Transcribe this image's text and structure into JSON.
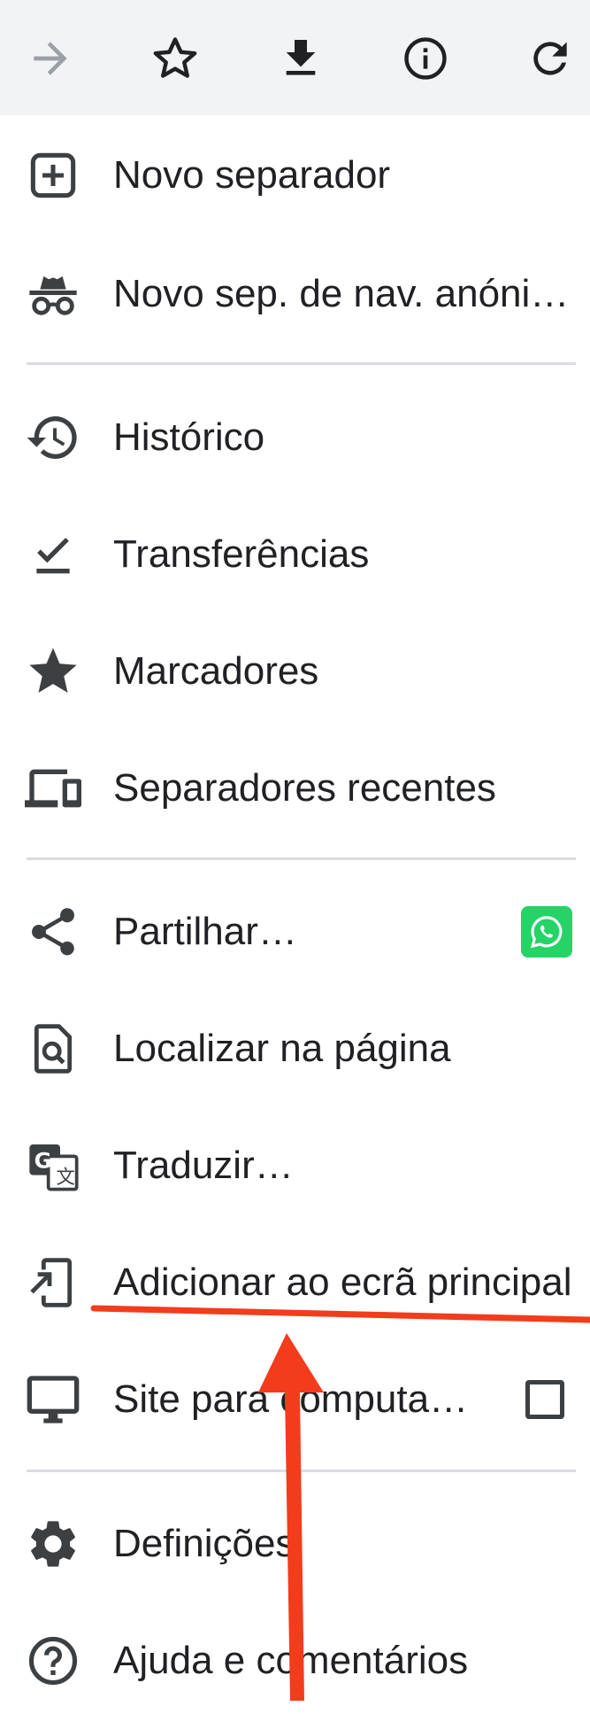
{
  "toolbar": {
    "buttons": [
      {
        "name": "forward-button",
        "icon": "arrow-forward-icon",
        "enabled": false
      },
      {
        "name": "bookmark-star-button",
        "icon": "star-outline-icon"
      },
      {
        "name": "download-button",
        "icon": "download-icon"
      },
      {
        "name": "page-info-button",
        "icon": "info-icon"
      },
      {
        "name": "reload-button",
        "icon": "reload-icon"
      }
    ]
  },
  "menu": {
    "items": [
      {
        "label": "Novo separador",
        "icon": "new-tab-icon"
      },
      {
        "label": "Novo sep. de nav. anóni…",
        "icon": "incognito-icon"
      },
      {
        "label": "Histórico",
        "icon": "history-icon"
      },
      {
        "label": "Transferências",
        "icon": "downloads-check-icon"
      },
      {
        "label": "Marcadores",
        "icon": "star-filled-icon"
      },
      {
        "label": "Separadores recentes",
        "icon": "devices-icon"
      },
      {
        "label": "Partilhar…",
        "icon": "share-icon",
        "trailing": "whatsapp-icon"
      },
      {
        "label": "Localizar na página",
        "icon": "find-in-page-icon"
      },
      {
        "label": "Traduzir…",
        "icon": "translate-icon"
      },
      {
        "label": "Adicionar ao ecrã principal",
        "icon": "add-to-home-screen-icon"
      },
      {
        "label": "Site para computa…",
        "icon": "desktop-icon",
        "trailing": "checkbox",
        "checked": false
      },
      {
        "label": "Definições",
        "icon": "settings-icon"
      },
      {
        "label": "Ajuda e comentários",
        "icon": "help-icon"
      }
    ]
  },
  "colors": {
    "toolbar_bg": "#f1f3f4",
    "icon": "#3c4043",
    "text": "#202124",
    "divider": "#dadce0",
    "whatsapp": "#25d366",
    "annotation": "#f23c1c"
  }
}
